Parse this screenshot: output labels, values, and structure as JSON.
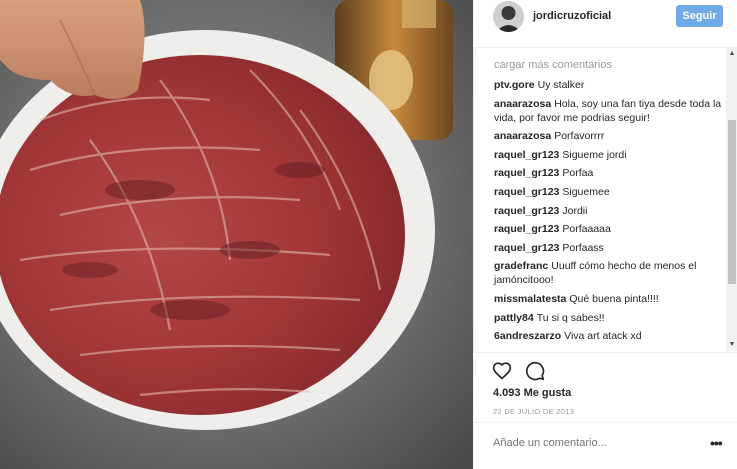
{
  "post": {
    "username": "jordicruzoficial",
    "follow_label": "Seguir",
    "likes": "4.093 Me gusta",
    "date": "22 DE JULIO DE 2013"
  },
  "comments": {
    "load_more": "cargar más comentarios",
    "items": [
      {
        "author": "ptv.gore",
        "text": "Uy stalker"
      },
      {
        "author": "anaarazosa",
        "text": "Hola, soy una fan tiya desde toda la vida, por favor me podrias seguir!"
      },
      {
        "author": "anaarazosa",
        "text": "Porfavorrrr"
      },
      {
        "author": "raquel_gr123",
        "text": "Sigueme jordi"
      },
      {
        "author": "raquel_gr123",
        "text": "Porfaa"
      },
      {
        "author": "raquel_gr123",
        "text": "Siguemee"
      },
      {
        "author": "raquel_gr123",
        "text": "Jordii"
      },
      {
        "author": "raquel_gr123",
        "text": "Porfaaaaa"
      },
      {
        "author": "raquel_gr123",
        "text": "Porfaass"
      },
      {
        "author": "gradefranc",
        "text": "Uuuff cómo hecho de menos el jamóncitooo!"
      },
      {
        "author": "missmalatesta",
        "text": "Qué buena pinta!!!!"
      },
      {
        "author": "pattly84",
        "text": "Tu si q sabes!!"
      },
      {
        "author": "6andreszarzo",
        "text": "Viva art atack xd"
      }
    ]
  },
  "composer": {
    "placeholder": "Añade un comentario..."
  },
  "icons": {
    "like": "heart-outline-icon",
    "comment": "speech-bubble-icon",
    "more": "more-options-icon",
    "scroll_up": "scroll-up-arrow-icon",
    "scroll_down": "scroll-down-arrow-icon"
  },
  "colors": {
    "follow_button": "#70a8e8",
    "meta_text": "#999999",
    "ham": "#a83a3a"
  }
}
